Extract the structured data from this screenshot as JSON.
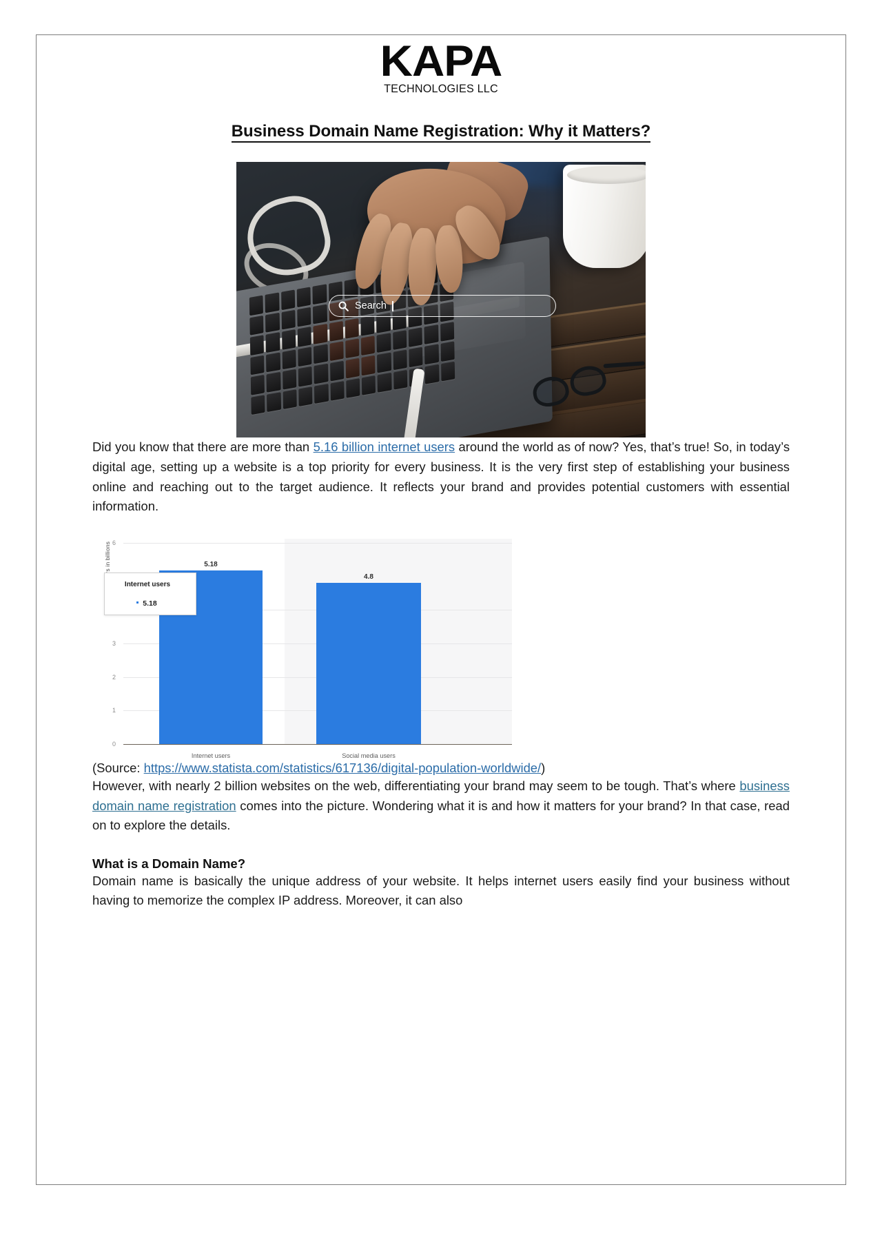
{
  "logo": {
    "word": "KAPA",
    "subtitle": "TECHNOLOGIES LLC"
  },
  "title": "Business Domain Name Registration: Why it Matters?",
  "hero": {
    "search_placeholder": "Search",
    "search_icon": "search-icon"
  },
  "paragraphs": {
    "p1_before_link": "Did you know that there are more than ",
    "p1_link": "5.16 billion internet users",
    "p1_after_link": " around the world as of now? Yes, that’s true! So, in today’s digital age, setting up a website is a top priority for every business. It is the very first step of establishing your business online and reaching out to the target audience. It reflects your brand and provides potential customers with essential information.",
    "p2_before_link": "However, with nearly 2 billion websites on the web, differentiating your brand may seem to be tough. That’s where ",
    "p2_link": "business domain name registration",
    "p2_after_link": " comes into the picture. Wondering what it is and how it matters for your brand? In that case, read on to explore the details.",
    "p3": "Domain name is basically the unique address of your website. It helps internet users easily find your business without having to memorize the complex IP address. Moreover, it can also"
  },
  "section_heading": "What is a Domain Name?",
  "source": {
    "prefix": "(Source: ",
    "url": "https://www.statista.com/statistics/617136/digital-population-worldwide/",
    "suffix": ")"
  },
  "colors": {
    "bar": "#2b7ce0",
    "link": "#2b6ca8",
    "page_border": "#7d7d7d",
    "chart_highlight": "#f6f6f7",
    "gridline": "#e6e6e8"
  },
  "chart_data": {
    "type": "bar",
    "title": "",
    "categories": [
      "Internet users",
      "Social media users"
    ],
    "values": [
      5.18,
      4.8
    ],
    "data_labels": [
      "5.18",
      "4.8"
    ],
    "xlabel": "",
    "ylabel": "Number of users in billions",
    "ylim": [
      0,
      6
    ],
    "yticks": [
      0,
      1,
      2,
      3,
      4,
      6
    ],
    "ytick_labels": [
      "0",
      "1",
      "2",
      "3",
      "4",
      "6"
    ],
    "grid": true,
    "legend": "none",
    "series_color": "#2b7ce0",
    "tooltip": {
      "title": "Internet users",
      "value": "5.18",
      "marker_color": "#2b7ce0"
    }
  }
}
